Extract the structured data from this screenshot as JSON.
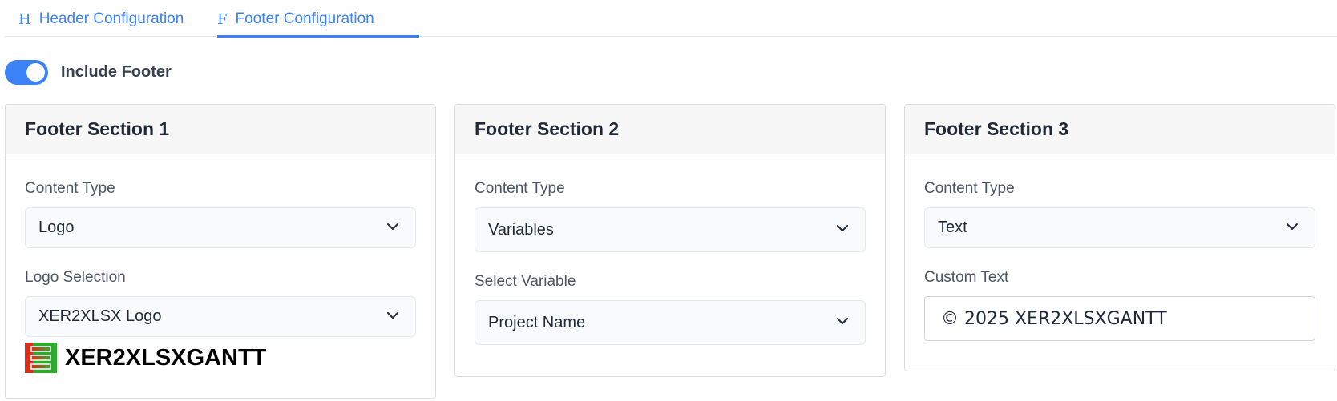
{
  "tabs": [
    {
      "icon": "H",
      "label": "Header Configuration",
      "active": false
    },
    {
      "icon": "F",
      "label": "Footer Configuration",
      "active": true
    }
  ],
  "include_footer": {
    "label": "Include Footer",
    "enabled": true
  },
  "sections": [
    {
      "title": "Footer Section 1",
      "content_type_label": "Content Type",
      "content_type_value": "Logo",
      "secondary_label": "Logo Selection",
      "secondary_value": "XER2XLSX Logo",
      "logo_text": "XER2XLSXGANTT"
    },
    {
      "title": "Footer Section 2",
      "content_type_label": "Content Type",
      "content_type_value": "Variables",
      "secondary_label": "Select Variable",
      "secondary_value": "Project Name"
    },
    {
      "title": "Footer Section 3",
      "content_type_label": "Content Type",
      "content_type_value": "Text",
      "secondary_label": "Custom Text",
      "secondary_value": "© 2025 XER2XLSXGANTT"
    }
  ],
  "colors": {
    "accent": "#3b82f6",
    "logo_red": "#d7301f",
    "logo_green": "#2eaa2e"
  }
}
